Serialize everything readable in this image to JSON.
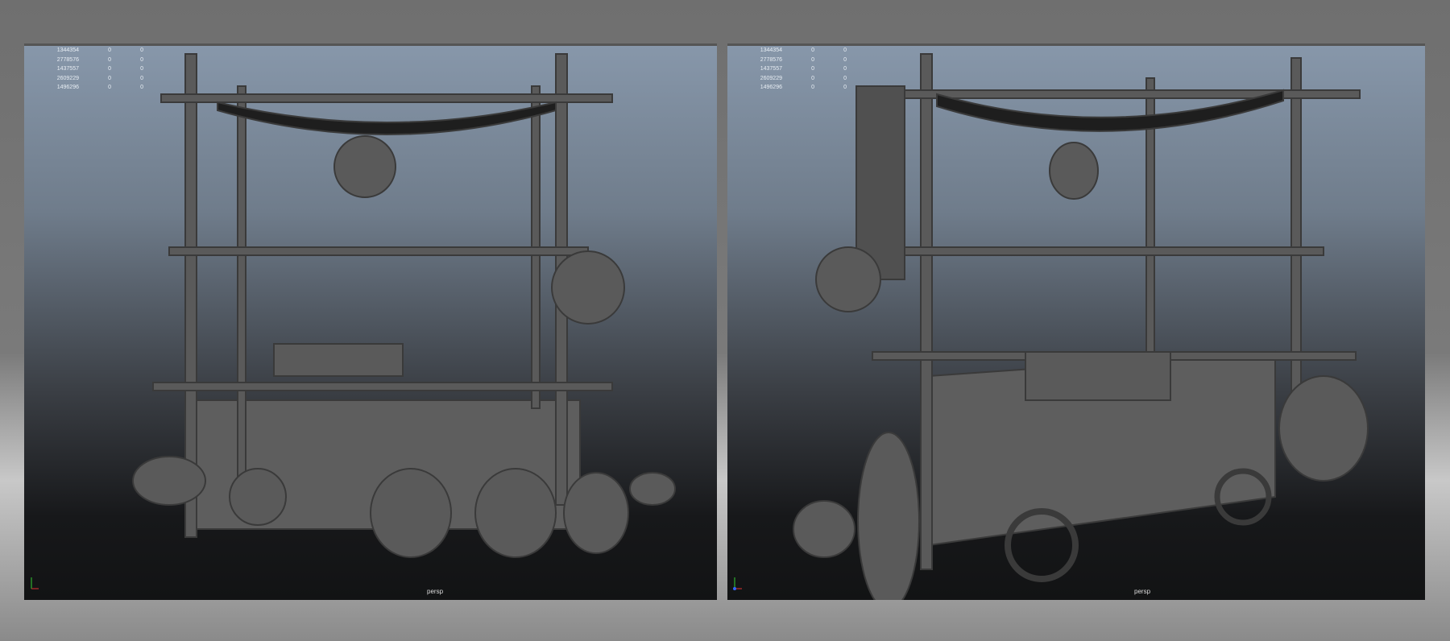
{
  "viewports": [
    {
      "camera_label": "persp",
      "stats": [
        [
          "1344354",
          "0",
          "0"
        ],
        [
          "2778576",
          "0",
          "0"
        ],
        [
          "1437557",
          "0",
          "0"
        ],
        [
          "2609229",
          "0",
          "0"
        ],
        [
          "1496296",
          "0",
          "0"
        ]
      ]
    },
    {
      "camera_label": "persp",
      "stats": [
        [
          "1344354",
          "0",
          "0"
        ],
        [
          "2778576",
          "0",
          "0"
        ],
        [
          "1437557",
          "0",
          "0"
        ],
        [
          "2609229",
          "0",
          "0"
        ],
        [
          "1496296",
          "0",
          "0"
        ]
      ]
    }
  ],
  "colors": {
    "model": "#5a5a5a",
    "model_light": "#707070",
    "bg_top": "#8797aa",
    "bg_bottom": "#121314"
  }
}
